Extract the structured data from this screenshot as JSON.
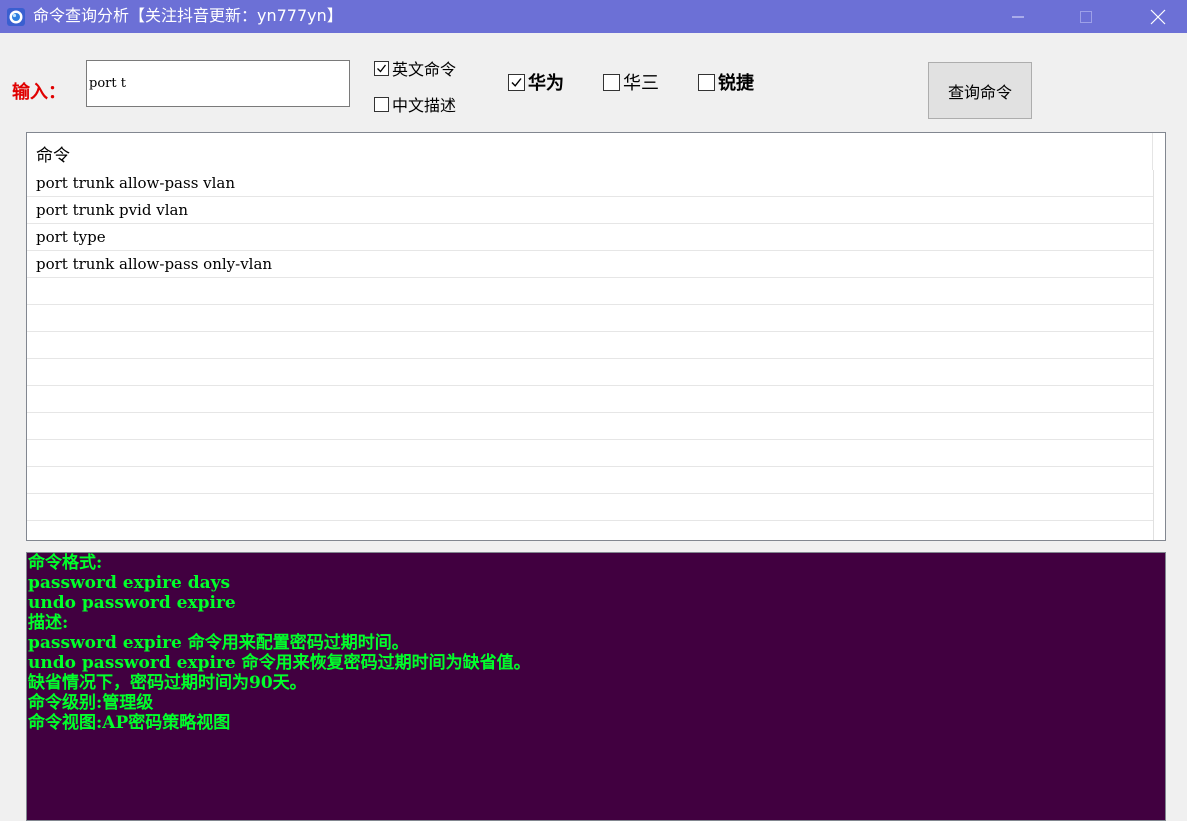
{
  "window": {
    "title": "命令查询分析【关注抖音更新：yn777yn】",
    "titlebar_color": "#6c70d6",
    "app_icon": "app-globe-icon",
    "controls": [
      "minimize-icon",
      "maximize-icon",
      "close-icon"
    ]
  },
  "search": {
    "label": "输入：",
    "value": "port t",
    "label_color": "#e00000"
  },
  "options": {
    "english_command": {
      "label": "英文命令",
      "checked": true
    },
    "chinese_desc": {
      "label": "中文描述",
      "checked": false
    }
  },
  "vendors": [
    {
      "label": "华为",
      "checked": true
    },
    {
      "label": "华三",
      "checked": false
    },
    {
      "label": "锐捷",
      "checked": false
    }
  ],
  "query_button": {
    "label": "查询命令"
  },
  "results": {
    "column_header": "命令",
    "rows": [
      "port trunk allow-pass vlan",
      "port trunk pvid vlan",
      "port type",
      "port trunk allow-pass only-vlan",
      "",
      "",
      "",
      "",
      "",
      "",
      "",
      "",
      "",
      ""
    ]
  },
  "detail": {
    "background": "#410040",
    "text_color": "#00ff2a",
    "lines": [
      "命令格式:",
      "password expire days",
      "undo password expire",
      "描述:",
      "password expire 命令用来配置密码过期时间。",
      "undo password expire 命令用来恢复密码过期时间为缺省值。",
      "缺省情况下，密码过期时间为90天。",
      "命令级别:管理级",
      "命令视图:AP密码策略视图"
    ]
  }
}
